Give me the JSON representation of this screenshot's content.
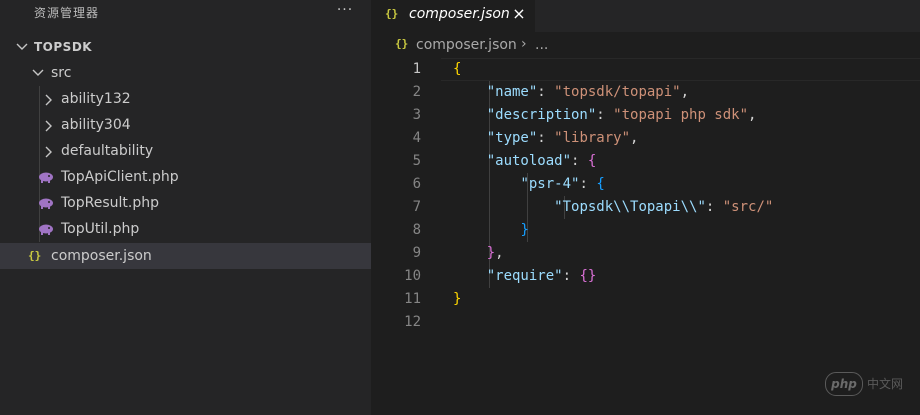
{
  "sidebar": {
    "title": "资源管理器",
    "more": "···",
    "root": "TOPSDK",
    "folder": "src",
    "subfolders": [
      "ability132",
      "ability304",
      "defaultability"
    ],
    "php_files": [
      "TopApiClient.php",
      "TopResult.php",
      "TopUtil.php"
    ],
    "root_file": "composer.json",
    "json_icon": "{}"
  },
  "tab": {
    "label": "composer.json",
    "close": "×",
    "icon": "{}"
  },
  "breadcrumb": {
    "file": "composer.json",
    "sep": "›",
    "more": "..."
  },
  "code": {
    "line_numbers": [
      "1",
      "2",
      "3",
      "4",
      "5",
      "6",
      "7",
      "8",
      "9",
      "10",
      "11",
      "12"
    ],
    "lines": [
      [
        {
          "c": "b1",
          "t": "{"
        }
      ],
      [
        {
          "c": "p",
          "t": "    "
        },
        {
          "c": "k",
          "t": "\"name\""
        },
        {
          "c": "p",
          "t": ": "
        },
        {
          "c": "s",
          "t": "\"topsdk/topapi\""
        },
        {
          "c": "p",
          "t": ","
        }
      ],
      [
        {
          "c": "p",
          "t": "    "
        },
        {
          "c": "k",
          "t": "\"description\""
        },
        {
          "c": "p",
          "t": ": "
        },
        {
          "c": "s",
          "t": "\"topapi php sdk\""
        },
        {
          "c": "p",
          "t": ","
        }
      ],
      [
        {
          "c": "p",
          "t": "    "
        },
        {
          "c": "k",
          "t": "\"type\""
        },
        {
          "c": "p",
          "t": ": "
        },
        {
          "c": "s",
          "t": "\"library\""
        },
        {
          "c": "p",
          "t": ","
        }
      ],
      [
        {
          "c": "p",
          "t": "    "
        },
        {
          "c": "k",
          "t": "\"autoload\""
        },
        {
          "c": "p",
          "t": ": "
        },
        {
          "c": "b2",
          "t": "{"
        }
      ],
      [
        {
          "c": "p",
          "t": "        "
        },
        {
          "c": "k",
          "t": "\"psr-4\""
        },
        {
          "c": "p",
          "t": ": "
        },
        {
          "c": "b3",
          "t": "{"
        }
      ],
      [
        {
          "c": "p",
          "t": "            "
        },
        {
          "c": "k",
          "t": "\"Topsdk\\\\Topapi\\\\\""
        },
        {
          "c": "p",
          "t": ": "
        },
        {
          "c": "s",
          "t": "\"src/\""
        }
      ],
      [
        {
          "c": "p",
          "t": "        "
        },
        {
          "c": "b3",
          "t": "}"
        }
      ],
      [
        {
          "c": "p",
          "t": "    "
        },
        {
          "c": "b2",
          "t": "}"
        },
        {
          "c": "p",
          "t": ","
        }
      ],
      [
        {
          "c": "p",
          "t": "    "
        },
        {
          "c": "k",
          "t": "\"require\""
        },
        {
          "c": "p",
          "t": ": "
        },
        {
          "c": "b2",
          "t": "{}"
        }
      ],
      [
        {
          "c": "b1",
          "t": "}"
        }
      ],
      []
    ]
  },
  "watermark": {
    "badge": "php",
    "text": "中文网"
  },
  "colors": {
    "sidebar_bg": "#252526",
    "editor_bg": "#1e1e1e",
    "selected_row": "#37373d",
    "json_icon": "#cbcb41",
    "php_icon": "#a074c4",
    "json_key": "#9cdcfe",
    "json_string": "#ce9178"
  }
}
